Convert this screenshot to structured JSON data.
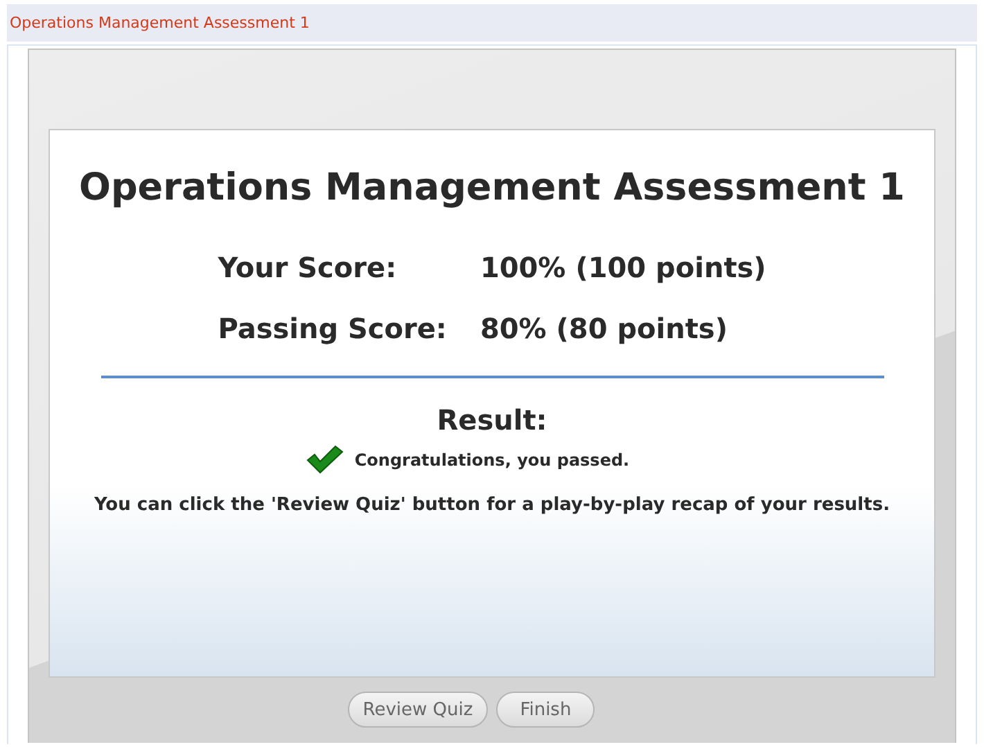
{
  "header": {
    "title": "Operations Management Assessment 1"
  },
  "result": {
    "title": "Operations Management Assessment 1",
    "scores": [
      {
        "label": "Your Score:",
        "value": "100% (100 points)"
      },
      {
        "label": "Passing Score:",
        "value": "80% (80 points)"
      }
    ],
    "result_label": "Result:",
    "passed": true,
    "message": "Congratulations, you passed.",
    "note": "You can click the 'Review Quiz' button for a play-by-play recap of your results."
  },
  "buttons": [
    "Review Quiz",
    "Finish"
  ]
}
